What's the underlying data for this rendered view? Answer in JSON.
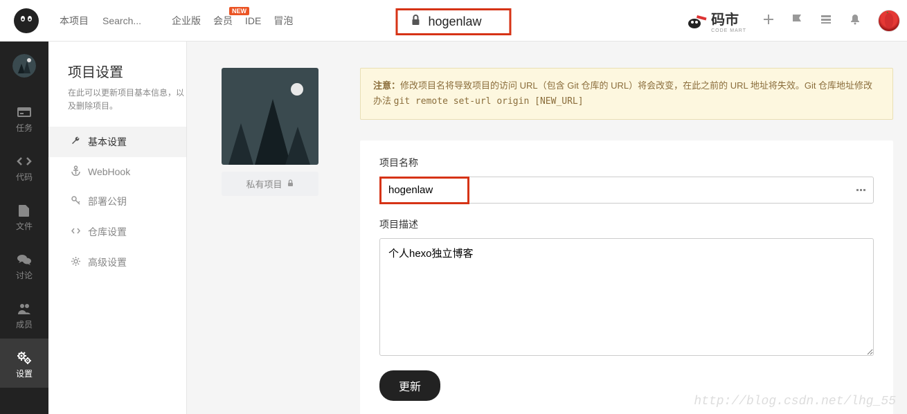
{
  "header": {
    "project_label": "本项目",
    "search_placeholder": "Search...",
    "nav": {
      "enterprise": "企业版",
      "member": "会员",
      "new_badge": "NEW",
      "ide": "IDE",
      "maopao": "冒泡"
    },
    "center_title": "hogenlaw",
    "mart_text": "码市",
    "mart_sub": "CODE MART"
  },
  "rail": {
    "tasks": "任务",
    "code": "代码",
    "files": "文件",
    "discuss": "讨论",
    "members": "成员",
    "settings": "设置"
  },
  "sidebar": {
    "title": "项目设置",
    "desc": "在此可以更新项目基本信息，以及删除项目。",
    "items": [
      {
        "label": "基本设置",
        "icon": "wrench"
      },
      {
        "label": "WebHook",
        "icon": "anchor"
      },
      {
        "label": "部署公钥",
        "icon": "key"
      },
      {
        "label": "仓库设置",
        "icon": "code"
      },
      {
        "label": "高级设置",
        "icon": "gear"
      }
    ]
  },
  "project": {
    "badge": "私有项目"
  },
  "warning": {
    "prefix": "注意：",
    "text1": "修改项目名将导致项目的访问 URL（包含 Git 仓库的 URL）将会改变，在此之前的 URL 地址将失效。Git 仓库地址修改办法 ",
    "code": "git remote set-url origin [NEW_URL]"
  },
  "form": {
    "name_label": "项目名称",
    "name_value": "hogenlaw",
    "desc_label": "项目描述",
    "desc_value": "个人hexo独立博客",
    "update_button": "更新"
  },
  "watermark": "http://blog.csdn.net/lhg_55"
}
